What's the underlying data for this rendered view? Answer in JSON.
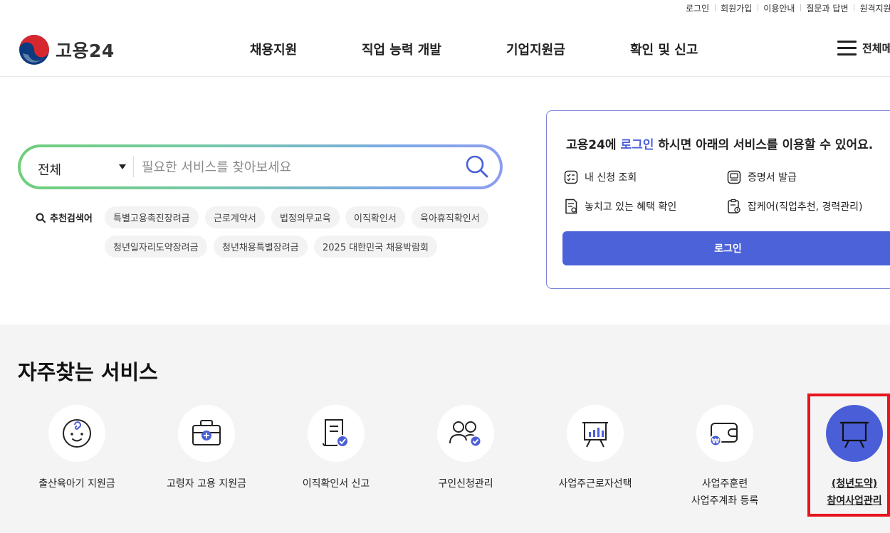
{
  "utility_links": [
    "로그인",
    "회원가입",
    "이용안내",
    "질문과 답변",
    "원격지원"
  ],
  "header": {
    "logo_text": "고용24",
    "nav": [
      "채용지원",
      "직업 능력 개발",
      "기업지원금",
      "확인 및 신고"
    ],
    "all_menu_label": "전체메뉴"
  },
  "search": {
    "category": "전체",
    "placeholder": "필요한 서비스를 찾아보세요",
    "recommend_label": "추천검색어",
    "keywords": [
      "특별고용촉진장려금",
      "근로계약서",
      "법정의무교육",
      "이직확인서",
      "육아휴직확인서",
      "청년일자리도약장려금",
      "청년채용특별장려금",
      "2025 대한민국 채용박람회"
    ]
  },
  "login_card": {
    "title_prefix": "고용24에 ",
    "title_accent": "로그인",
    "title_suffix": " 하시면 아래의 서비스를 이용할 수 있어요.",
    "services": [
      {
        "label": "내 신청 조회",
        "icon": "checklist-icon"
      },
      {
        "label": "증명서 발급",
        "icon": "certificate-icon"
      },
      {
        "label": "놓치고 있는 혜택 확인",
        "icon": "benefit-document-icon"
      },
      {
        "label": "잡케어(직업추천, 경력관리)",
        "icon": "jobcare-icon"
      }
    ],
    "button_label": "로그인",
    "accent_color": "#4a5fd7"
  },
  "frequent": {
    "title": "자주찾는 서비스",
    "items": [
      {
        "line1": "출산육아기 지원금",
        "line2": "",
        "icon": "baby-icon"
      },
      {
        "line1": "고령자 고용 지원금",
        "line2": "",
        "icon": "briefcase-icon"
      },
      {
        "line1": "이직확인서 신고",
        "line2": "",
        "icon": "document-check-icon"
      },
      {
        "line1": "구인신청관리",
        "line2": "",
        "icon": "people-check-icon"
      },
      {
        "line1": "사업주근로자선택",
        "line2": "",
        "icon": "chart-board-icon"
      },
      {
        "line1": "사업주훈련",
        "line2": "사업주계좌 등록",
        "icon": "wallet-icon"
      },
      {
        "line1": "(청년도약)",
        "line2": "참여사업관리",
        "icon": "easel-icon"
      }
    ],
    "highlight_color": "#e8141c"
  }
}
